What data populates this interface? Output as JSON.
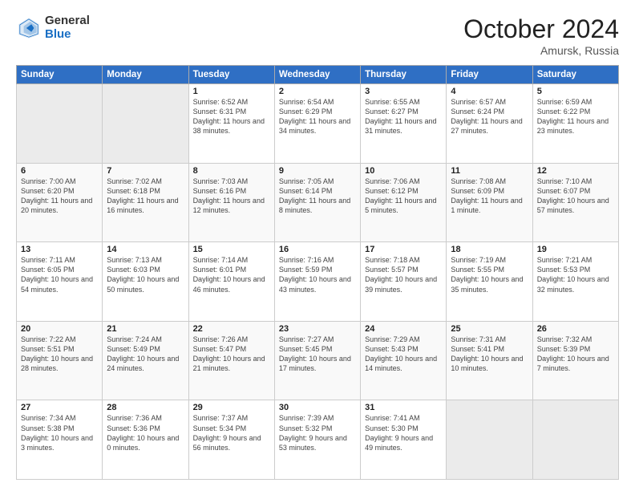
{
  "header": {
    "logo_general": "General",
    "logo_blue": "Blue",
    "month": "October 2024",
    "location": "Amursk, Russia"
  },
  "days_of_week": [
    "Sunday",
    "Monday",
    "Tuesday",
    "Wednesday",
    "Thursday",
    "Friday",
    "Saturday"
  ],
  "weeks": [
    [
      {
        "day": "",
        "sunrise": "",
        "sunset": "",
        "daylight": ""
      },
      {
        "day": "",
        "sunrise": "",
        "sunset": "",
        "daylight": ""
      },
      {
        "day": "1",
        "sunrise": "Sunrise: 6:52 AM",
        "sunset": "Sunset: 6:31 PM",
        "daylight": "Daylight: 11 hours and 38 minutes."
      },
      {
        "day": "2",
        "sunrise": "Sunrise: 6:54 AM",
        "sunset": "Sunset: 6:29 PM",
        "daylight": "Daylight: 11 hours and 34 minutes."
      },
      {
        "day": "3",
        "sunrise": "Sunrise: 6:55 AM",
        "sunset": "Sunset: 6:27 PM",
        "daylight": "Daylight: 11 hours and 31 minutes."
      },
      {
        "day": "4",
        "sunrise": "Sunrise: 6:57 AM",
        "sunset": "Sunset: 6:24 PM",
        "daylight": "Daylight: 11 hours and 27 minutes."
      },
      {
        "day": "5",
        "sunrise": "Sunrise: 6:59 AM",
        "sunset": "Sunset: 6:22 PM",
        "daylight": "Daylight: 11 hours and 23 minutes."
      }
    ],
    [
      {
        "day": "6",
        "sunrise": "Sunrise: 7:00 AM",
        "sunset": "Sunset: 6:20 PM",
        "daylight": "Daylight: 11 hours and 20 minutes."
      },
      {
        "day": "7",
        "sunrise": "Sunrise: 7:02 AM",
        "sunset": "Sunset: 6:18 PM",
        "daylight": "Daylight: 11 hours and 16 minutes."
      },
      {
        "day": "8",
        "sunrise": "Sunrise: 7:03 AM",
        "sunset": "Sunset: 6:16 PM",
        "daylight": "Daylight: 11 hours and 12 minutes."
      },
      {
        "day": "9",
        "sunrise": "Sunrise: 7:05 AM",
        "sunset": "Sunset: 6:14 PM",
        "daylight": "Daylight: 11 hours and 8 minutes."
      },
      {
        "day": "10",
        "sunrise": "Sunrise: 7:06 AM",
        "sunset": "Sunset: 6:12 PM",
        "daylight": "Daylight: 11 hours and 5 minutes."
      },
      {
        "day": "11",
        "sunrise": "Sunrise: 7:08 AM",
        "sunset": "Sunset: 6:09 PM",
        "daylight": "Daylight: 11 hours and 1 minute."
      },
      {
        "day": "12",
        "sunrise": "Sunrise: 7:10 AM",
        "sunset": "Sunset: 6:07 PM",
        "daylight": "Daylight: 10 hours and 57 minutes."
      }
    ],
    [
      {
        "day": "13",
        "sunrise": "Sunrise: 7:11 AM",
        "sunset": "Sunset: 6:05 PM",
        "daylight": "Daylight: 10 hours and 54 minutes."
      },
      {
        "day": "14",
        "sunrise": "Sunrise: 7:13 AM",
        "sunset": "Sunset: 6:03 PM",
        "daylight": "Daylight: 10 hours and 50 minutes."
      },
      {
        "day": "15",
        "sunrise": "Sunrise: 7:14 AM",
        "sunset": "Sunset: 6:01 PM",
        "daylight": "Daylight: 10 hours and 46 minutes."
      },
      {
        "day": "16",
        "sunrise": "Sunrise: 7:16 AM",
        "sunset": "Sunset: 5:59 PM",
        "daylight": "Daylight: 10 hours and 43 minutes."
      },
      {
        "day": "17",
        "sunrise": "Sunrise: 7:18 AM",
        "sunset": "Sunset: 5:57 PM",
        "daylight": "Daylight: 10 hours and 39 minutes."
      },
      {
        "day": "18",
        "sunrise": "Sunrise: 7:19 AM",
        "sunset": "Sunset: 5:55 PM",
        "daylight": "Daylight: 10 hours and 35 minutes."
      },
      {
        "day": "19",
        "sunrise": "Sunrise: 7:21 AM",
        "sunset": "Sunset: 5:53 PM",
        "daylight": "Daylight: 10 hours and 32 minutes."
      }
    ],
    [
      {
        "day": "20",
        "sunrise": "Sunrise: 7:22 AM",
        "sunset": "Sunset: 5:51 PM",
        "daylight": "Daylight: 10 hours and 28 minutes."
      },
      {
        "day": "21",
        "sunrise": "Sunrise: 7:24 AM",
        "sunset": "Sunset: 5:49 PM",
        "daylight": "Daylight: 10 hours and 24 minutes."
      },
      {
        "day": "22",
        "sunrise": "Sunrise: 7:26 AM",
        "sunset": "Sunset: 5:47 PM",
        "daylight": "Daylight: 10 hours and 21 minutes."
      },
      {
        "day": "23",
        "sunrise": "Sunrise: 7:27 AM",
        "sunset": "Sunset: 5:45 PM",
        "daylight": "Daylight: 10 hours and 17 minutes."
      },
      {
        "day": "24",
        "sunrise": "Sunrise: 7:29 AM",
        "sunset": "Sunset: 5:43 PM",
        "daylight": "Daylight: 10 hours and 14 minutes."
      },
      {
        "day": "25",
        "sunrise": "Sunrise: 7:31 AM",
        "sunset": "Sunset: 5:41 PM",
        "daylight": "Daylight: 10 hours and 10 minutes."
      },
      {
        "day": "26",
        "sunrise": "Sunrise: 7:32 AM",
        "sunset": "Sunset: 5:39 PM",
        "daylight": "Daylight: 10 hours and 7 minutes."
      }
    ],
    [
      {
        "day": "27",
        "sunrise": "Sunrise: 7:34 AM",
        "sunset": "Sunset: 5:38 PM",
        "daylight": "Daylight: 10 hours and 3 minutes."
      },
      {
        "day": "28",
        "sunrise": "Sunrise: 7:36 AM",
        "sunset": "Sunset: 5:36 PM",
        "daylight": "Daylight: 10 hours and 0 minutes."
      },
      {
        "day": "29",
        "sunrise": "Sunrise: 7:37 AM",
        "sunset": "Sunset: 5:34 PM",
        "daylight": "Daylight: 9 hours and 56 minutes."
      },
      {
        "day": "30",
        "sunrise": "Sunrise: 7:39 AM",
        "sunset": "Sunset: 5:32 PM",
        "daylight": "Daylight: 9 hours and 53 minutes."
      },
      {
        "day": "31",
        "sunrise": "Sunrise: 7:41 AM",
        "sunset": "Sunset: 5:30 PM",
        "daylight": "Daylight: 9 hours and 49 minutes."
      },
      {
        "day": "",
        "sunrise": "",
        "sunset": "",
        "daylight": ""
      },
      {
        "day": "",
        "sunrise": "",
        "sunset": "",
        "daylight": ""
      }
    ]
  ]
}
